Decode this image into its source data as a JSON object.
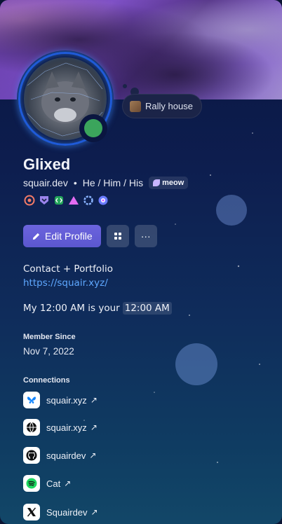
{
  "status": {
    "text": "Rally house"
  },
  "profile": {
    "display_name": "Glixed",
    "handle": "squair.dev",
    "pronouns": "He / Him / His",
    "separator": "•",
    "badge_text": "meow"
  },
  "badges": [
    "hypesquad-icon",
    "nitro-icon",
    "server-boost-icon",
    "active-developer-icon",
    "quest-icon",
    "orbs-icon"
  ],
  "buttons": {
    "edit_profile": "Edit Profile",
    "more": "···"
  },
  "bio": {
    "line1": "Contact + Portfolio",
    "link": "https://squair.xyz/",
    "time_prefix": "My 12:00 AM is your",
    "time_chip": "12:00 AM"
  },
  "member_since": {
    "title": "Member Since",
    "date": "Nov 7, 2022"
  },
  "connections": {
    "title": "Connections",
    "items": [
      {
        "label": "squair.xyz",
        "icon": "bluesky-icon",
        "arrow": "↗"
      },
      {
        "label": "squair.xyz",
        "icon": "globe-icon",
        "arrow": "↗"
      },
      {
        "label": "squairdev",
        "icon": "github-icon",
        "arrow": "↗"
      },
      {
        "label": "Cat",
        "icon": "spotify-icon",
        "arrow": "↗"
      },
      {
        "label": "Squairdev",
        "icon": "x-icon",
        "arrow": "↗"
      }
    ]
  },
  "colors": {
    "accent": "#5b57cf",
    "online": "#3ba55c",
    "link": "#5ea8ff"
  }
}
